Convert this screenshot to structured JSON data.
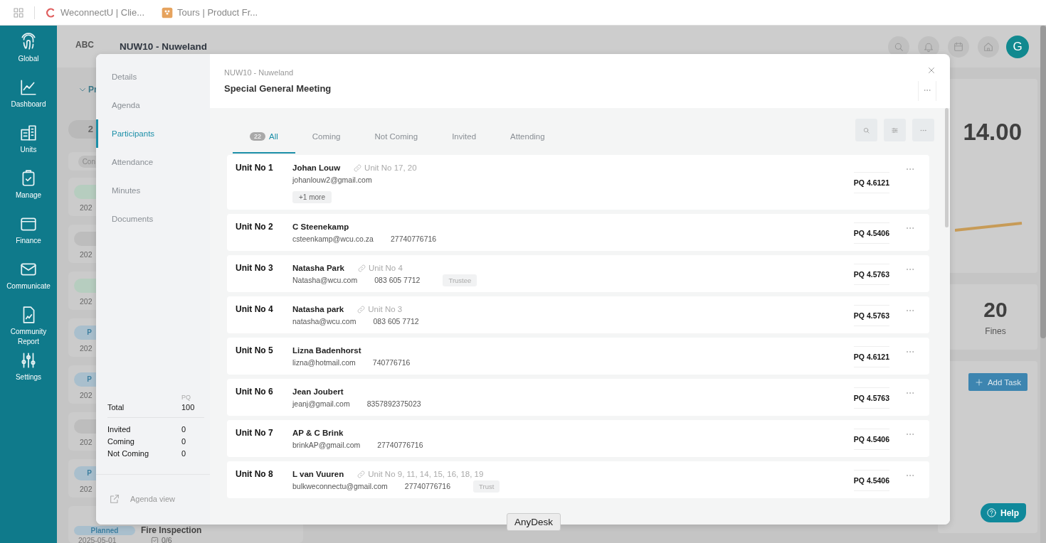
{
  "bookmarks": [
    {
      "title": "WeconnectU | Clie..."
    },
    {
      "title": "Tours | Product Fr..."
    }
  ],
  "nav": {
    "items": [
      {
        "label": "Global"
      },
      {
        "label": "Dashboard"
      },
      {
        "label": "Units"
      },
      {
        "label": "Manage"
      },
      {
        "label": "Finance"
      },
      {
        "label": "Communicate"
      },
      {
        "label": "Community Report"
      },
      {
        "label": "Settings"
      }
    ]
  },
  "app_header": {
    "logo": "ABC",
    "title": "NUW10 - Nuweland",
    "avatar": "G"
  },
  "background": {
    "filter": "Pr",
    "count": "2",
    "chip": "Con",
    "tasks": [
      {
        "color": "#b6cdbf",
        "date": "202"
      },
      {
        "color": "#bdbdbd",
        "date": "202"
      },
      {
        "color": "#b6cdbf",
        "date": "202"
      },
      {
        "color": "#a9bfcd",
        "status": "P",
        "date": "202"
      },
      {
        "color": "#a9bfcd",
        "status": "P",
        "date": "202"
      },
      {
        "color": "#bdbdbd",
        "date": "202"
      },
      {
        "color": "#a9bfcd",
        "status": "P",
        "date": "202"
      }
    ],
    "last_task": {
      "status": "Planned",
      "title": "Fire Inspection",
      "date": "2025-05-01",
      "checklist": "0/6"
    },
    "stat_value": "14.00",
    "fines_value": "20",
    "fines_label": "Fines",
    "add_task": "Add Task"
  },
  "modal": {
    "menu": [
      {
        "label": "Details",
        "selected": false
      },
      {
        "label": "Agenda",
        "selected": false
      },
      {
        "label": "Participants",
        "selected": true
      },
      {
        "label": "Attendance",
        "selected": false
      },
      {
        "label": "Minutes",
        "selected": false
      },
      {
        "label": "Documents",
        "selected": false
      }
    ],
    "summary": {
      "pq_header": "PQ",
      "total_label": "Total",
      "total_value": "100",
      "rows": [
        {
          "label": "Invited",
          "value": "0"
        },
        {
          "label": "Coming",
          "value": "0"
        },
        {
          "label": "Not Coming",
          "value": "0"
        }
      ]
    },
    "agenda_link": "Agenda view",
    "subtitle": "NUW10 - Nuweland",
    "title": "Special General Meeting",
    "tabs": [
      {
        "label": "All",
        "count": "22",
        "selected": true
      },
      {
        "label": "Coming",
        "selected": false
      },
      {
        "label": "Not Coming",
        "selected": false
      },
      {
        "label": "Invited",
        "selected": false
      },
      {
        "label": "Attending",
        "selected": false
      }
    ],
    "participants": [
      {
        "unit": "Unit No 1",
        "name": "Johan Louw",
        "linked": "Unit No 17, 20",
        "email": "johanlouw2@gmail.com",
        "more": "+1 more",
        "pq": "PQ 4.6121"
      },
      {
        "unit": "Unit No 2",
        "name": "C Steenekamp",
        "email": "csteenkamp@wcu.co.za",
        "phone": "27740776716",
        "pq": "PQ 4.5406"
      },
      {
        "unit": "Unit No 3",
        "name": "Natasha Park",
        "linked": "Unit No 4",
        "email": "Natasha@wcu.com",
        "phone": "083 605 7712",
        "tag": "Trustee",
        "pq": "PQ 4.5763"
      },
      {
        "unit": "Unit No 4",
        "name": "Natasha park",
        "linked": "Unit No 3",
        "email": "natasha@wcu.com",
        "phone": "083 605 7712",
        "pq": "PQ 4.5763"
      },
      {
        "unit": "Unit No 5",
        "name": "Lizna Badenhorst",
        "email": "lizna@hotmail.com",
        "phone": "740776716",
        "pq": "PQ 4.6121"
      },
      {
        "unit": "Unit No 6",
        "name": "Jean Joubert",
        "email": "jeanj@gmail.com",
        "phone": "8357892375023",
        "pq": "PQ 4.5763"
      },
      {
        "unit": "Unit No 7",
        "name": "AP & C Brink",
        "email": "brinkAP@gmail.com",
        "phone": "27740776716",
        "pq": "PQ 4.5406"
      },
      {
        "unit": "Unit No 8",
        "name": "L van Vuuren",
        "linked": "Unit No 9, 11, 14, 15, 16, 18, 19",
        "email": "bulkweconnectu@gmail.com",
        "phone": "27740776716",
        "tag": "Trust",
        "pq": "PQ 4.5406"
      }
    ]
  },
  "help": "Help",
  "tooltip": "AnyDesk"
}
